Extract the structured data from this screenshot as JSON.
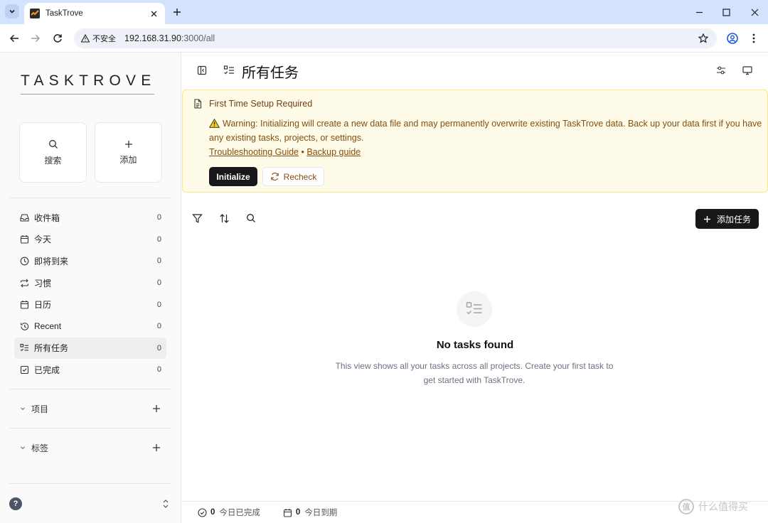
{
  "browser": {
    "tab_title": "TaskTrove",
    "security_label": "不安全",
    "url_host": "192.168.31.90",
    "url_rest": ":3000/all"
  },
  "sidebar": {
    "logo": "TASKTROVE",
    "quick_actions": [
      {
        "label": "搜索",
        "icon": "search-icon"
      },
      {
        "label": "添加",
        "icon": "plus-icon"
      }
    ],
    "nav": [
      {
        "label": "收件箱",
        "count": "0",
        "icon": "inbox-icon"
      },
      {
        "label": "今天",
        "count": "0",
        "icon": "calendar-icon"
      },
      {
        "label": "即将到来",
        "count": "0",
        "icon": "clock-icon"
      },
      {
        "label": "习惯",
        "count": "0",
        "icon": "repeat-icon"
      },
      {
        "label": "日历",
        "count": "0",
        "icon": "calendar-icon"
      },
      {
        "label": "Recent",
        "count": "0",
        "icon": "history-icon"
      },
      {
        "label": "所有任务",
        "count": "0",
        "icon": "list-todo-icon",
        "active": true
      },
      {
        "label": "已完成",
        "count": "0",
        "icon": "check-square-icon"
      }
    ],
    "sections": [
      {
        "label": "项目"
      },
      {
        "label": "标签"
      }
    ],
    "help_label": "?"
  },
  "main": {
    "title": "所有任务",
    "banner": {
      "title": "First Time Setup Required",
      "warning": "Warning: Initializing will create a new data file and may permanently overwrite existing TaskTrove data. Back up your data first if you have any existing tasks, projects, or settings.",
      "link1": "Troubleshooting Guide",
      "separator": "•",
      "link2": "Backup guide",
      "initialize_label": "Initialize",
      "recheck_label": "Recheck"
    },
    "add_task_label": "添加任务",
    "empty": {
      "title": "No tasks found",
      "description": "This view shows all your tasks across all projects. Create your first task to get started with TaskTrove."
    },
    "status": {
      "completed_count": "0",
      "completed_label": "今日已完成",
      "due_count": "0",
      "due_label": "今日到期"
    }
  },
  "watermark": {
    "symbol": "值",
    "text": "什么值得买"
  },
  "colors": {
    "tabbar": "#d3e3fd",
    "banner_bg": "#fefce8",
    "banner_border": "#fde68a",
    "banner_text": "#854d0e",
    "primary_button": "#18181b"
  }
}
